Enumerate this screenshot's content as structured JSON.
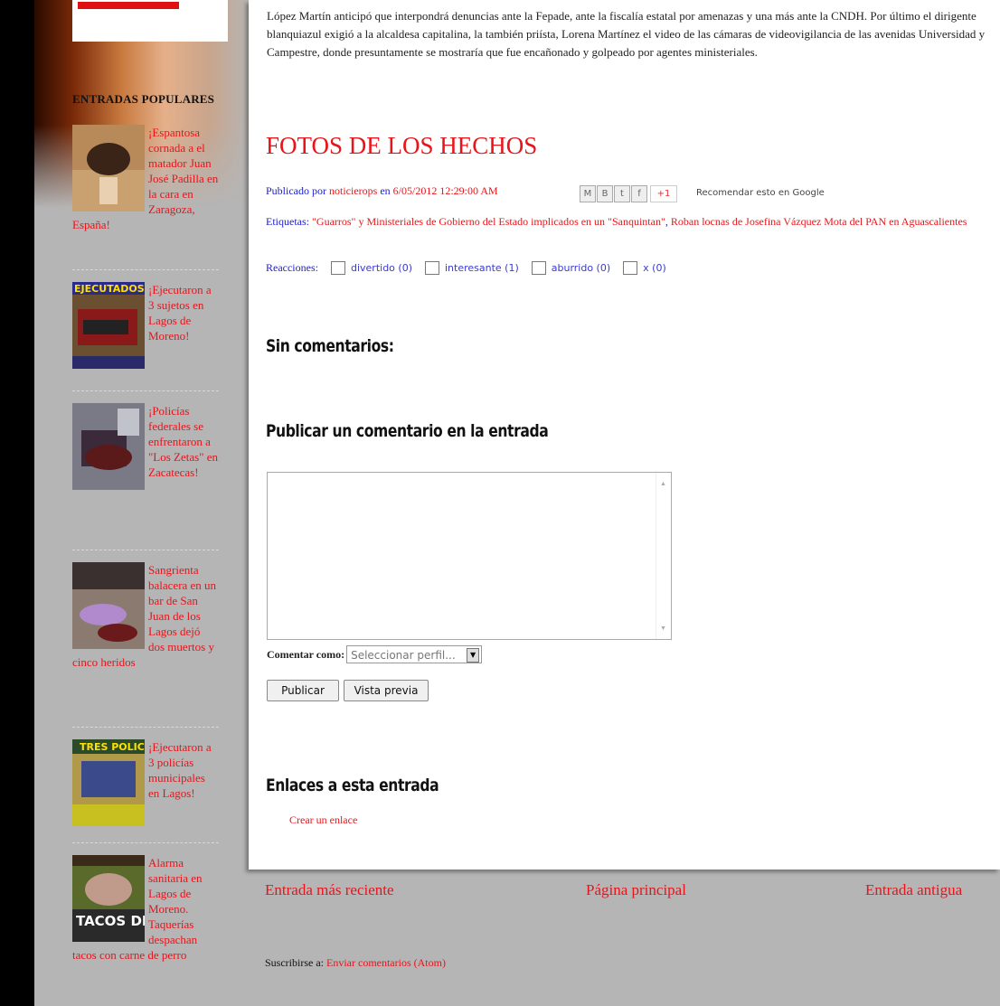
{
  "colors": {
    "link_red": "#e8141a",
    "link_blue": "#1c1cd0",
    "page_bg": "#b5b5b5"
  },
  "sidebar": {
    "title": "ENTRADAS POPULARES",
    "items": [
      {
        "text": "¡Espantosa cornada a el matador Juan José Padilla en la cara en Zaragoza, España!",
        "thumb_icon": "bullfight-photo"
      },
      {
        "text": "¡Ejecutaron a 3 sujetos en Lagos de Moreno!",
        "thumb_icon": "news-photo",
        "thumb_caption": "EJECUTADOS"
      },
      {
        "text": "¡Policías federales se enfrentaron a \"Los Zetas\" en Zacatecas!",
        "thumb_icon": "crime-photo"
      },
      {
        "text": "Sangrienta balacera en un bar de San Juan de los Lagos dejó dos muertos y cinco heridos",
        "thumb_icon": "crime-photo"
      },
      {
        "text": "¡Ejecutaron a 3 policías municipales en Lagos!",
        "thumb_icon": "news-photo",
        "thumb_caption": "TRES POLIC"
      },
      {
        "text": "Alarma sanitaria en Lagos de Moreno. Taquerías despachan tacos con carne de perro",
        "thumb_icon": "tacos-photo",
        "thumb_caption": "TACOS DE"
      }
    ]
  },
  "post": {
    "paragraph": "López Martín anticipó que interpondrá denuncias ante la Fepade, ante la fiscalía estatal por amenazas y una más ante la CNDH. Por último el dirigente blanquiazul exigió a la alcaldesa capitalina, la también priísta, Lorena Martínez el video de las cámaras de videovigilancia de las avenidas Universidad y Campestre, donde presuntamente se mostraría que fue encañonado y golpeado por agentes ministeriales.",
    "title": "FOTOS DE LOS HECHOS",
    "published_prefix": "Publicado por",
    "author": "noticierops",
    "published_on": "en",
    "timestamp": "6/05/2012 12:29:00 AM",
    "share_buttons": [
      "M",
      "B",
      "t",
      "f"
    ],
    "plus_one": "+1",
    "recommend": "Recomendar esto en Google",
    "tags_label": "Etiquetas:",
    "tag1": "\"Guarros\" y Ministeriales de Gobierno del Estado implicados en un \"Sanquintan\"",
    "tag2": "Roban locnas de Josefina Vázquez Mota del PAN en Aguascalientes",
    "reactions_label": "Reacciones:",
    "reactions": [
      "divertido (0)",
      "interesante (1)",
      "aburrido (0)",
      "x (0)"
    ]
  },
  "comments": {
    "heading": "Sin comentarios:",
    "publish_heading": "Publicar un comentario en la entrada",
    "comment_as_label": "Comentar como:",
    "profile_select": "Seleccionar perfil...",
    "publish_button": "Publicar",
    "preview_button": "Vista previa",
    "links_heading": "Enlaces a esta entrada",
    "create_link": "Crear un enlace"
  },
  "nav": {
    "newer": "Entrada más reciente",
    "home": "Página principal",
    "older": "Entrada antigua"
  },
  "subscribe": {
    "prefix": "Suscribirse a:",
    "link": "Enviar comentarios (Atom)"
  }
}
